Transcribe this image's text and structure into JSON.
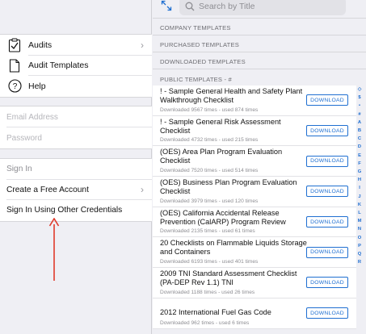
{
  "menu": {
    "items": [
      {
        "label": "Audits",
        "icon": "clipboard-check-icon",
        "chevron": "›"
      },
      {
        "label": "Audit Templates",
        "icon": "document-icon"
      },
      {
        "label": "Help",
        "icon": "help-circle-icon"
      }
    ]
  },
  "credentials": {
    "email_placeholder": "Email Address",
    "password_placeholder": "Password"
  },
  "sign": {
    "sign_in": "Sign In",
    "create_account": "Create a Free Account",
    "create_chevron": "›",
    "other_credentials": "Sign In Using Other Credentials"
  },
  "annotation": {
    "arrow_color": "#e0392b"
  },
  "search": {
    "placeholder": "Search by Title"
  },
  "sections": {
    "company": "COMPANY TEMPLATES",
    "purchased": "PURCHASED TEMPLATES",
    "downloaded": "DOWNLOADED TEMPLATES",
    "public": "PUBLIC TEMPLATES - #"
  },
  "templates": [
    {
      "title": "! - Sample General Health and Safety Plant Walkthrough Checklist",
      "meta": "Downloaded 9567 times - used 874 times",
      "button": "DOWNLOAD"
    },
    {
      "title": "! - Sample General Risk Assessment Checklist",
      "meta": "Downloaded 4732 times - used 215 times",
      "button": "DOWNLOAD"
    },
    {
      "title": "(OES) Area Plan Program Evaluation Checklist",
      "meta": "Downloaded 7520 times - used 514 times",
      "button": "DOWNLOAD"
    },
    {
      "title": "(OES) Business Plan Program Evaluation Checklist",
      "meta": "Downloaded 3979 times - used 120 times",
      "button": "DOWNLOAD"
    },
    {
      "title": "(OES) California Accidental Release Prevention (CalARP) Program Review",
      "meta": "Downloaded 2135 times - used 61 times",
      "button": "DOWNLOAD"
    },
    {
      "title": "20 Checklists on Flammable Liquids Storage and Containers",
      "meta": "Downloaded 6193 times - used 401 times",
      "button": "DOWNLOAD"
    },
    {
      "title": "2009 TNI Standard Assessment Checklist (PA-DEP Rev 1.1) TNI",
      "meta": "Downloaded 1188 times - used 26 times",
      "button": "DOWNLOAD"
    },
    {
      "title": "2012 International Fuel Gas Code",
      "meta": "Downloaded 962 times - used 6 times",
      "button": "DOWNLOAD"
    }
  ],
  "index_letters": [
    "◇",
    "$",
    "•",
    "#",
    "A",
    "B",
    "C",
    "D",
    "E",
    "F",
    "G",
    "H",
    "I",
    "J",
    "K",
    "L",
    "M",
    "N",
    "O",
    "P",
    "Q",
    "R"
  ],
  "colors": {
    "accent": "#1f6fd1",
    "background": "#efeff4"
  }
}
